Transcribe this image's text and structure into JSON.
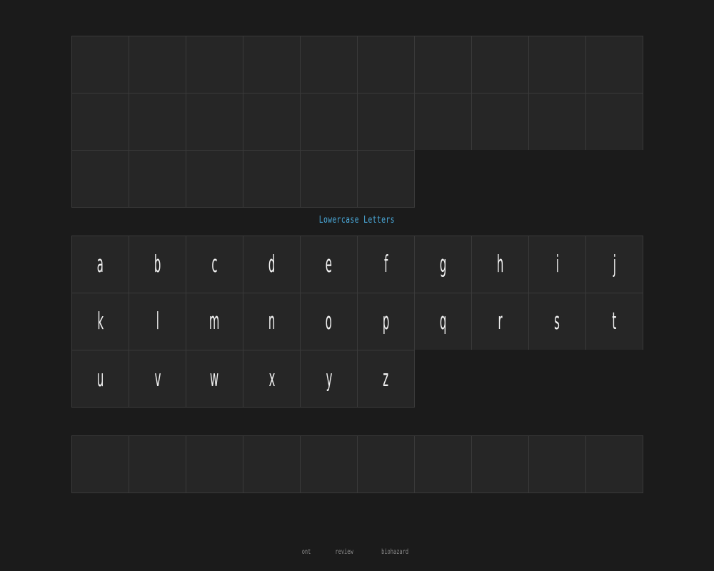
{
  "section": {
    "title": "Lowercase Letters"
  },
  "top_grid": {
    "row_counts": [
      10,
      10,
      6
    ]
  },
  "lowercase": {
    "rows": [
      [
        "a",
        "b",
        "c",
        "d",
        "e",
        "f",
        "g",
        "h",
        "i",
        "j"
      ],
      [
        "k",
        "l",
        "m",
        "n",
        "o",
        "p",
        "q",
        "r",
        "s",
        "t"
      ],
      [
        "u",
        "v",
        "w",
        "x",
        "y",
        "z"
      ]
    ]
  },
  "bottom_grid": {
    "row_counts": [
      10
    ]
  },
  "footer": {
    "items": [
      "ont",
      "review",
      "biohazard"
    ]
  },
  "colors": {
    "background": "#1b1b1b",
    "cell": "#262626",
    "cell_border": "#3a3a3a",
    "title_accent": "#4aa8d8",
    "glyph": "#f2f2f2",
    "footer_text": "#8a8a8a"
  }
}
